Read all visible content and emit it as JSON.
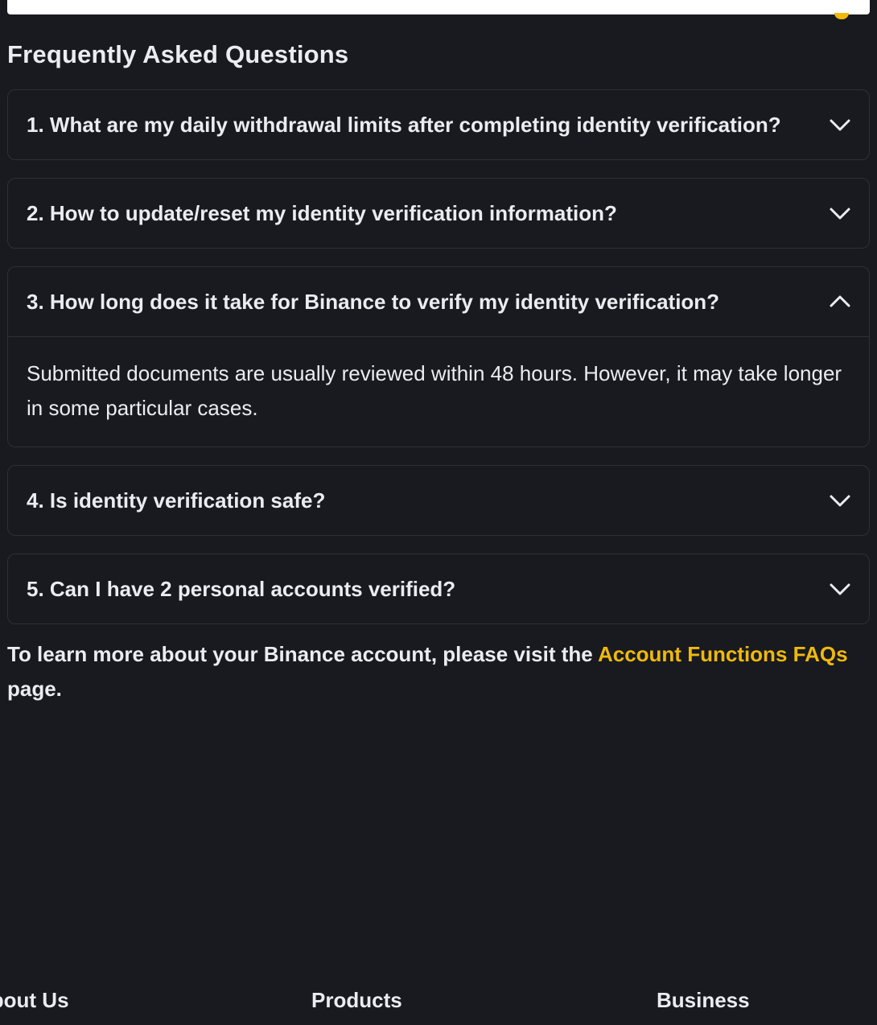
{
  "colors": {
    "background": "#181a20",
    "border": "#2b3139",
    "text": "#eaecef",
    "accent": "#f0b90b"
  },
  "faq": {
    "title": "Frequently Asked Questions",
    "items": [
      {
        "question": "1. What are my daily withdrawal limits after completing identity verification?",
        "expanded": false,
        "icon": "chevron-down-icon"
      },
      {
        "question": "2. How to update/reset my identity verification information?",
        "expanded": false,
        "icon": "chevron-down-icon"
      },
      {
        "question": "3. How long does it take for Binance to verify my identity verification?",
        "expanded": true,
        "icon": "chevron-up-icon",
        "answer": "Submitted documents are usually reviewed within 48 hours. However, it may take longer in some particular cases."
      },
      {
        "question": "4. Is identity verification safe?",
        "expanded": false,
        "icon": "chevron-down-icon"
      },
      {
        "question": "5. Can I have 2 personal accounts verified?",
        "expanded": false,
        "icon": "chevron-down-icon"
      }
    ]
  },
  "learn_more": {
    "prefix": "To learn more about your Binance account, please visit the ",
    "link_text": "Account Functions FAQs",
    "suffix": " page."
  },
  "footer": {
    "about": "About Us",
    "products": "Products",
    "business": "Business"
  }
}
